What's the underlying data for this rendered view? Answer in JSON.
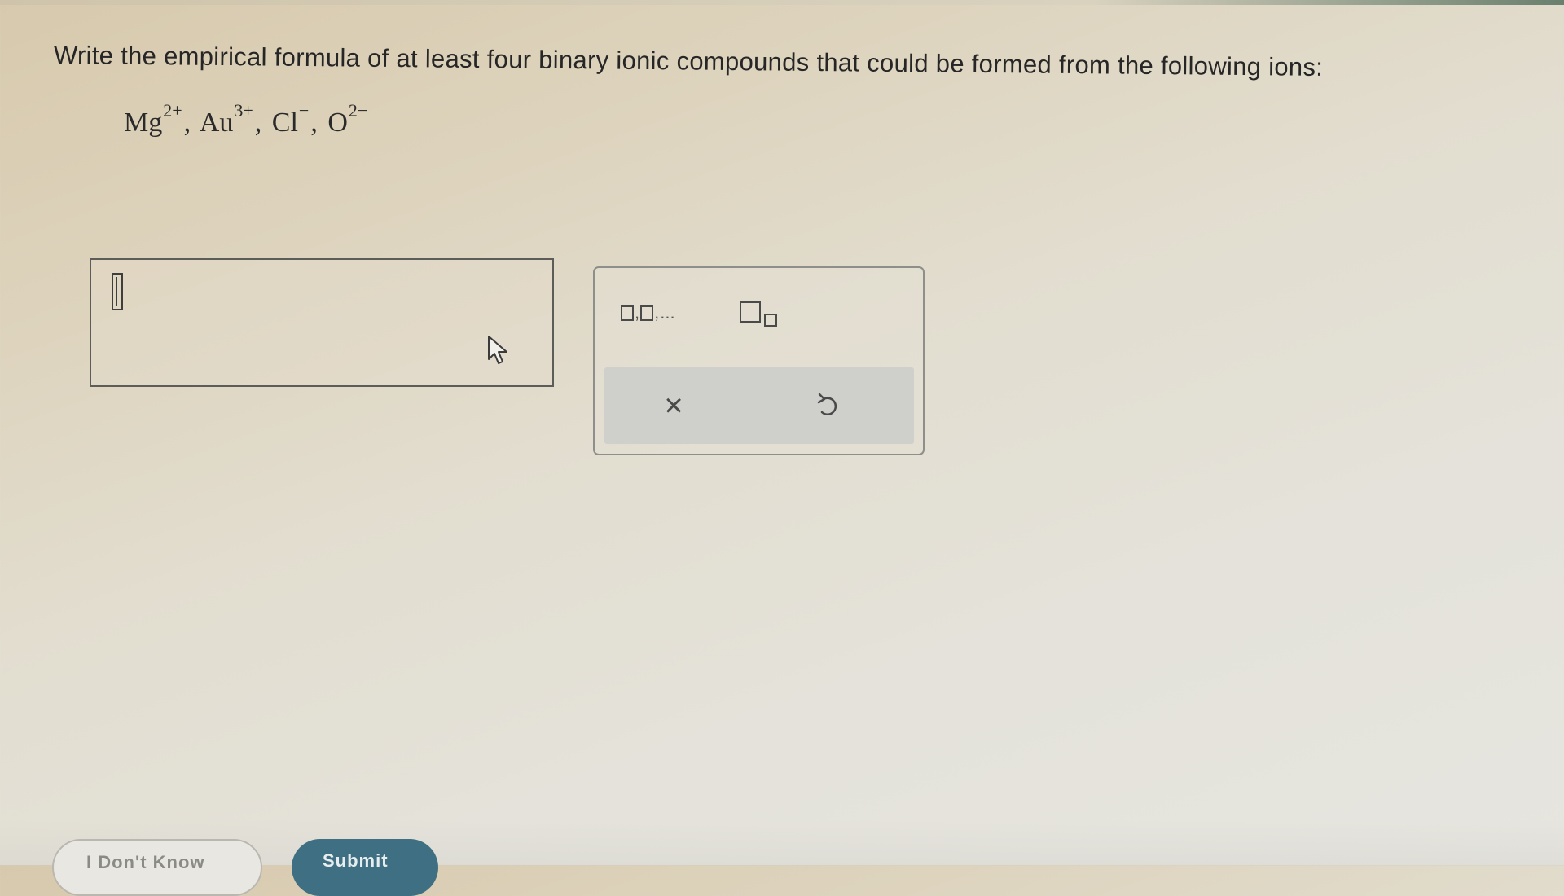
{
  "question": {
    "prompt": "Write the empirical formula of at least four binary ionic compounds that could be formed from the following ions:",
    "ions": [
      {
        "symbol": "Mg",
        "charge": "2+"
      },
      {
        "symbol": "Au",
        "charge": "3+"
      },
      {
        "symbol": "Cl",
        "charge": "−"
      },
      {
        "symbol": "O",
        "charge": "2−"
      }
    ],
    "separator": ","
  },
  "answer": {
    "value": ""
  },
  "toolbar": {
    "list_tool_label": "□,□,...",
    "list_tool_ellipsis": "...",
    "subscript_tool_icon": "subscript-icon",
    "clear_label": "×",
    "undo_icon": "undo-icon"
  },
  "footer": {
    "dont_know_label": "I Don't Know",
    "submit_label": "Submit"
  },
  "colors": {
    "submit_bg": "#3f6f82",
    "border": "#5c5c58"
  }
}
